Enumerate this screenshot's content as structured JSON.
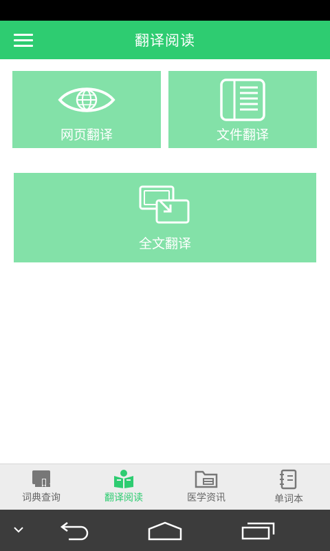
{
  "app_bar": {
    "title": "翻译阅读"
  },
  "tiles": {
    "web": {
      "label": "网页翻译",
      "icon": "eye-globe-icon"
    },
    "file": {
      "label": "文件翻译",
      "icon": "document-icon"
    },
    "full": {
      "label": "全文翻译",
      "icon": "copy-expand-icon"
    }
  },
  "bottom_nav": {
    "items": [
      {
        "label": "词典查询",
        "icon": "dictionary-book-icon",
        "active": false
      },
      {
        "label": "翻译阅读",
        "icon": "reading-icon",
        "active": true
      },
      {
        "label": "医学资讯",
        "icon": "folder-news-icon",
        "active": false
      },
      {
        "label": "单词本",
        "icon": "notebook-icon",
        "active": false
      }
    ]
  },
  "colors": {
    "app_bar": "#2ecc71",
    "tile": "#83e1a8",
    "nav_active": "#2ecc71",
    "nav_inactive": "#666666",
    "system_nav": "#3c3c3c"
  }
}
